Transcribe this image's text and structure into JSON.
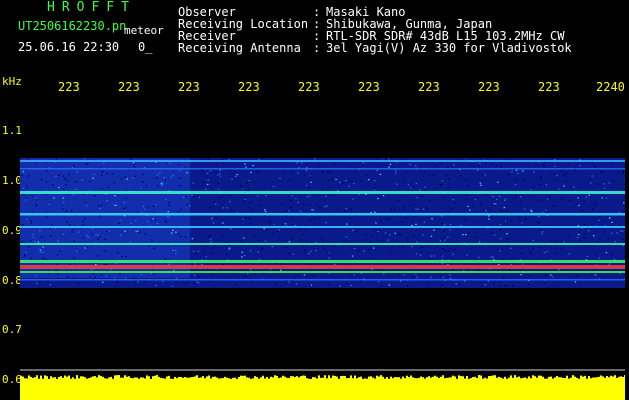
{
  "header": {
    "brand": "HROFFT",
    "filename": "UT2506162230.pn",
    "filename_tag": "meteor",
    "datetime": "25.06.16 22:30",
    "count": "0_",
    "fields": [
      {
        "label": "Observer",
        "value": "Masaki Kano"
      },
      {
        "label": "Receiving Location",
        "value": "Shibukawa, Gunma, Japan"
      },
      {
        "label": "Receiver",
        "value": "RTL-SDR SDR# 43dB L15 103.2MHz CW"
      },
      {
        "label": "Receiving Antenna",
        "value": "3el Yagi(V) Az 330 for Vladivostok"
      }
    ]
  },
  "axis": {
    "y_unit": "kHz",
    "x_ticks": [
      "223",
      "223",
      "223",
      "223",
      "223",
      "223",
      "223",
      "223",
      "223",
      "2240"
    ],
    "y_ticks": [
      "1.1",
      "1.0",
      "0.9",
      "0.8",
      "0.7",
      "0.6"
    ]
  },
  "colors": {
    "header_title": "#3cff3c",
    "header_text": "#ffffff",
    "axis": "#ffff00",
    "background": "#000000"
  }
}
